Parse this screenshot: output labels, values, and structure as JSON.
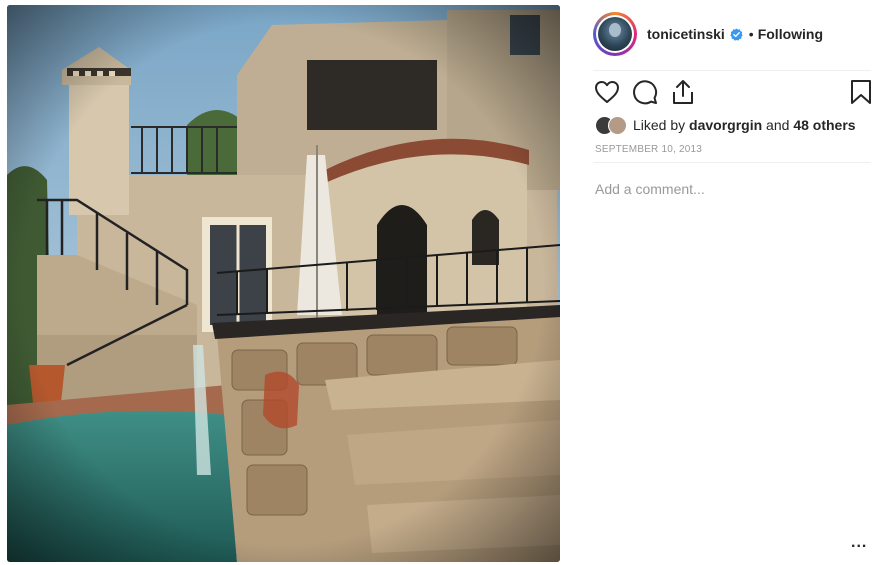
{
  "post": {
    "photo_alt": "Stone villa with pool and staircase",
    "icon": "photo"
  },
  "header": {
    "username": "tonicetinski",
    "verified_icon": "verified-badge-icon",
    "separator": "•",
    "follow_state": "Following"
  },
  "actions": {
    "like_icon": "heart-icon",
    "comment_icon": "comment-icon",
    "share_icon": "share-icon",
    "save_icon": "bookmark-icon"
  },
  "likes": {
    "prefix": "Liked by ",
    "user": "davorgrgin",
    "middle": " and ",
    "others": "48 others"
  },
  "date": "September 10, 2013",
  "comment": {
    "placeholder": "Add a comment..."
  },
  "more_label": "...",
  "colors": {
    "verified": "#3897f0",
    "text": "#262626",
    "muted": "#999999",
    "divider": "#efefef"
  }
}
